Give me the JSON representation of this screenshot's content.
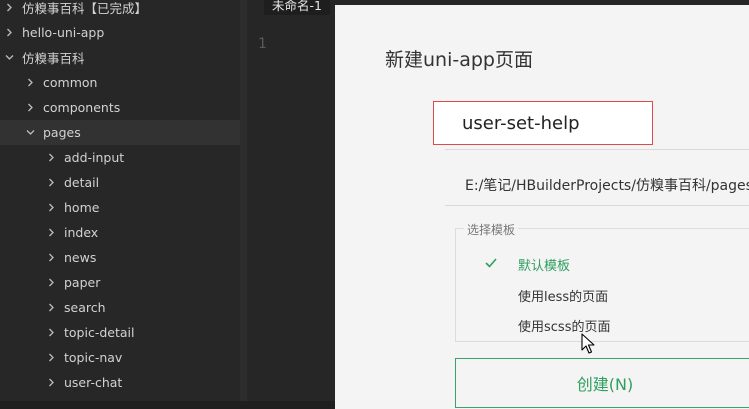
{
  "sidebar": {
    "items": [
      {
        "label": "仿糗事百科【已完成】",
        "level": 0,
        "expanded": false
      },
      {
        "label": "hello-uni-app",
        "level": 0,
        "expanded": false
      },
      {
        "label": "仿糗事百科",
        "level": 0,
        "expanded": true
      },
      {
        "label": "common",
        "level": 1,
        "expanded": false
      },
      {
        "label": "components",
        "level": 1,
        "expanded": false
      },
      {
        "label": "pages",
        "level": 1,
        "expanded": true
      },
      {
        "label": "add-input",
        "level": 2,
        "expanded": false
      },
      {
        "label": "detail",
        "level": 2,
        "expanded": false
      },
      {
        "label": "home",
        "level": 2,
        "expanded": false
      },
      {
        "label": "index",
        "level": 2,
        "expanded": false
      },
      {
        "label": "news",
        "level": 2,
        "expanded": false
      },
      {
        "label": "paper",
        "level": 2,
        "expanded": false
      },
      {
        "label": "search",
        "level": 2,
        "expanded": false
      },
      {
        "label": "topic-detail",
        "level": 2,
        "expanded": false
      },
      {
        "label": "topic-nav",
        "level": 2,
        "expanded": false
      },
      {
        "label": "user-chat",
        "level": 2,
        "expanded": false
      }
    ]
  },
  "editor": {
    "tab_label": "未命名-1",
    "line_number": "1"
  },
  "dialog": {
    "title": "新建uni-app页面",
    "page_name_value": "user-set-help",
    "path": "E:/笔记/HBuilderProjects/仿糗事百科/pages",
    "template_group_label": "选择模板",
    "templates": [
      {
        "label": "默认模板",
        "selected": true
      },
      {
        "label": "使用less的页面",
        "selected": false
      },
      {
        "label": "使用scss的页面",
        "selected": false
      }
    ],
    "create_button_label": "创建(N)"
  },
  "colors": {
    "accent": "#2e9f5f",
    "error_border": "#e04a4a",
    "sidebar_bg": "#272727",
    "dialog_bg": "#f4f4f4"
  }
}
